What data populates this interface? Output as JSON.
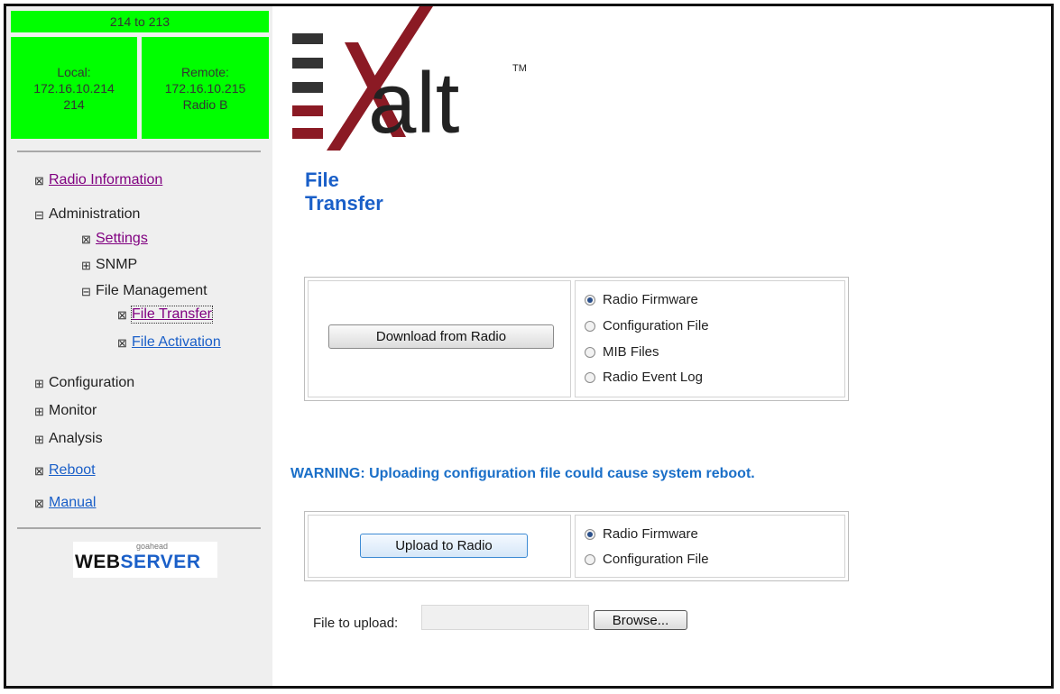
{
  "link": {
    "title": "214 to 213"
  },
  "local": {
    "label": "Local:",
    "ip": "172.16.10.214",
    "name": "214"
  },
  "remote": {
    "label": "Remote:",
    "ip": "172.16.10.215",
    "name": "Radio B"
  },
  "nav": {
    "radio_information": "Radio Information",
    "administration": "Administration",
    "settings": "Settings",
    "snmp": "SNMP",
    "file_management": "File Management",
    "file_transfer": "File Transfer",
    "file_activation": "File Activation",
    "configuration": "Configuration",
    "monitor": "Monitor",
    "analysis": "Analysis",
    "reboot": "Reboot",
    "manual": "Manual"
  },
  "server_badge": {
    "small": "goahead",
    "web": "WEB",
    "server": "SERVER"
  },
  "brand": {
    "logo_text": "alt",
    "tm": "TM"
  },
  "page": {
    "title_line1": "File",
    "title_line2": "Transfer"
  },
  "download": {
    "button_label": "Download from Radio",
    "options": [
      "Radio Firmware",
      "Configuration File",
      "MIB Files",
      "Radio Event Log"
    ],
    "selected": "Radio Firmware"
  },
  "warning": "WARNING: Uploading configuration file could cause system reboot.",
  "upload": {
    "button_label": "Upload to Radio",
    "options": [
      "Radio Firmware",
      "Configuration File"
    ],
    "selected": "Radio Firmware"
  },
  "file": {
    "label": "File to upload:",
    "value": "",
    "browse_label": "Browse..."
  },
  "colors": {
    "status_green": "#00ff00",
    "title_blue": "#1a5fc8",
    "logo_red": "#8b1a24",
    "logo_gray": "#333333"
  }
}
